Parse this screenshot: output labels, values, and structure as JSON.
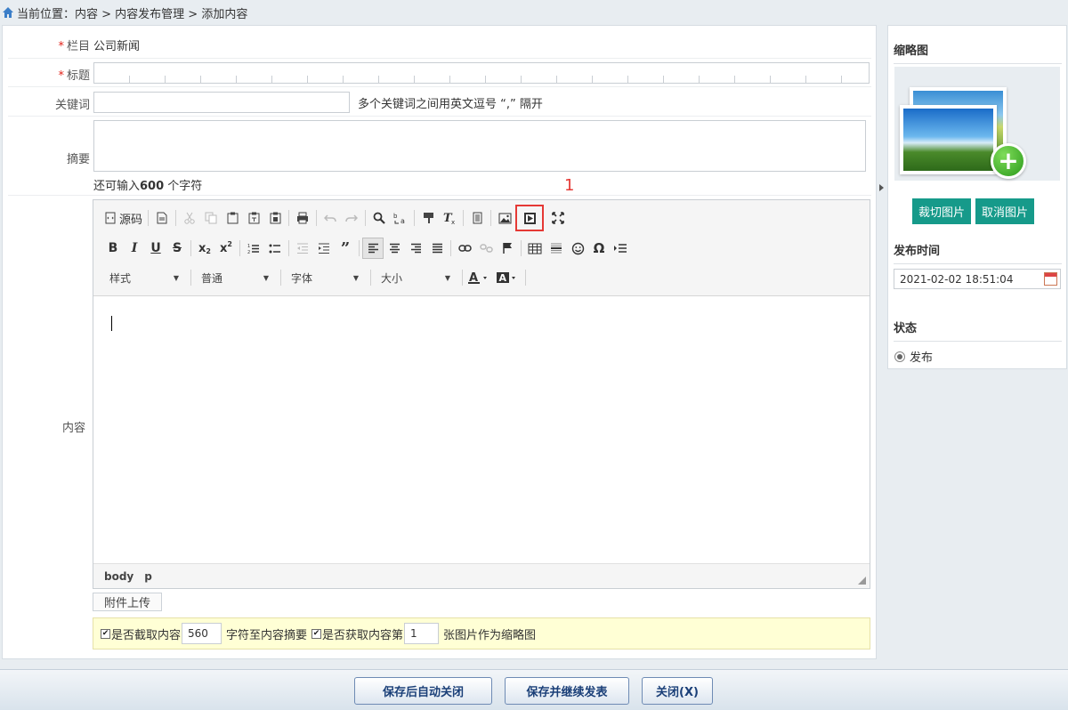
{
  "breadcrumb": {
    "text": "当前位置：内容 > 内容发布管理 > 添加内容"
  },
  "form": {
    "column": {
      "label": "栏目",
      "value": "公司新闻"
    },
    "title": {
      "label": "标题",
      "value": ""
    },
    "keywords": {
      "label": "关键词",
      "value": "",
      "hint": "多个关键词之间用英文逗号 “,” 隔开"
    },
    "summary": {
      "label": "摘要",
      "value": "",
      "remain_prefix": "还可输入",
      "remain_count": "600",
      "remain_suffix": " 个字符"
    },
    "content": {
      "label": "内容"
    }
  },
  "editor": {
    "source_label": "源码",
    "combos": {
      "style": "样式",
      "format": "普通",
      "font": "字体",
      "size": "大小"
    },
    "path": [
      "body",
      "p"
    ]
  },
  "attach_label": "附件上传",
  "options": {
    "cut_prefix": "是否截取内容",
    "cut_value": "560",
    "cut_suffix": "字符至内容摘要",
    "img_prefix": "是否获取内容第",
    "img_value": "1",
    "img_suffix": "张图片作为缩略图"
  },
  "sidebar": {
    "thumb_title": "缩略图",
    "crop_button": "裁切图片",
    "cancel_button": "取消图片",
    "publish_time_title": "发布时间",
    "publish_time": "2021-02-02 18:51:04",
    "status_title": "状态",
    "status_option": "发布"
  },
  "footer": {
    "save_close": "保存后自动关闭",
    "save_continue": "保存并继续发表",
    "close": "关闭(X)"
  },
  "annotation": "1",
  "colors": {
    "teal": "#169a8a",
    "highlight": "#e53935",
    "required": "#e2231a"
  }
}
